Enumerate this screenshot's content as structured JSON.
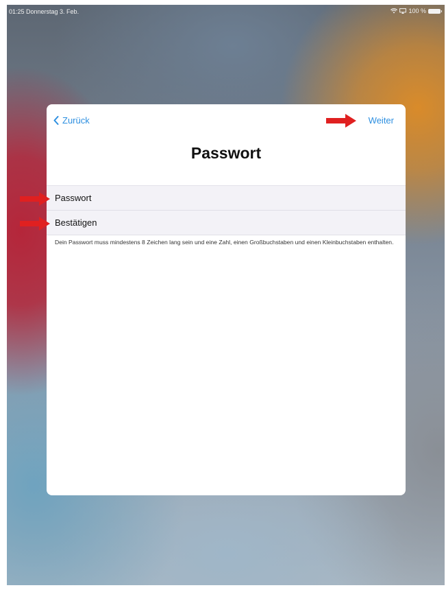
{
  "status_bar": {
    "time_date": "01:25 Donnerstag 3. Feb.",
    "battery_label": "100 %",
    "icons": [
      "wifi-icon",
      "screen-mirroring-icon",
      "battery-icon"
    ]
  },
  "sheet": {
    "back_label": "Zurück",
    "next_label": "Weiter",
    "title": "Passwort",
    "fields": [
      {
        "label": "Passwort"
      },
      {
        "label": "Bestätigen"
      }
    ],
    "hint": "Dein Passwort muss mindestens 8 Zeichen lang sein und eine Zahl, einen Großbuchstaben und einen Kleinbuchstaben enthalten."
  },
  "colors": {
    "accent": "#2d8fe0",
    "annotation_arrow": "#e02020",
    "field_background": "#f3f2f7"
  }
}
